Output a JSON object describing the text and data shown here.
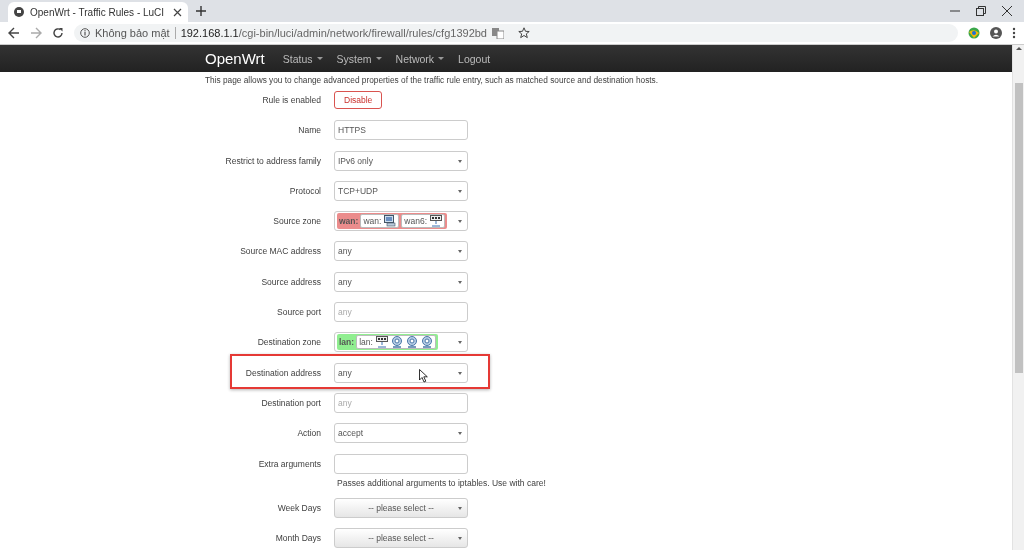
{
  "browser": {
    "tab_title": "OpenWrt - Traffic Rules - LuCI",
    "security_label": "Không bảo mật",
    "url_host": "192.168.1.1",
    "url_path": "/cgi-bin/luci/admin/network/firewall/rules/cfg1392bd"
  },
  "nav": {
    "brand": "OpenWrt",
    "menus": [
      {
        "label": "Status",
        "dropdown": true
      },
      {
        "label": "System",
        "dropdown": true
      },
      {
        "label": "Network",
        "dropdown": true
      },
      {
        "label": "Logout",
        "dropdown": false
      }
    ]
  },
  "intro": "This page allows you to change advanced properties of the traffic rule entry, such as matched source and destination hosts.",
  "rows": [
    {
      "label": "Rule is enabled",
      "kind": "button",
      "value": "Disable",
      "highlighted": false
    },
    {
      "label": "Name",
      "kind": "text",
      "value": "HTTPS",
      "highlighted": false
    },
    {
      "label": "Restrict to address family",
      "kind": "select",
      "value": "IPv6 only",
      "highlighted": false
    },
    {
      "label": "Protocol",
      "kind": "select",
      "value": "TCP+UDP",
      "highlighted": false
    },
    {
      "label": "Source zone",
      "kind": "zone",
      "zone": "wan:",
      "color": "#eb8c8c",
      "networks": [
        {
          "label": "wan:",
          "icons": [
            {
              "kind": "computer"
            }
          ]
        },
        {
          "label": "wan6:",
          "icons": [
            {
              "kind": "port"
            }
          ]
        }
      ],
      "highlighted": false
    },
    {
      "label": "Source MAC address",
      "kind": "select",
      "value": "any",
      "highlighted": false
    },
    {
      "label": "Source address",
      "kind": "select",
      "value": "any",
      "highlighted": false
    },
    {
      "label": "Source port",
      "kind": "text",
      "placeholder": "any",
      "highlighted": false
    },
    {
      "label": "Destination zone",
      "kind": "zone",
      "zone": "lan:",
      "color": "#90ee90",
      "networks": [
        {
          "label": "lan:",
          "icons": [
            {
              "kind": "port"
            },
            {
              "kind": "wireless"
            },
            {
              "kind": "wireless"
            },
            {
              "kind": "wireless"
            }
          ]
        }
      ],
      "highlighted": false
    },
    {
      "label": "Destination address",
      "kind": "select",
      "value": "any",
      "highlighted": true
    },
    {
      "label": "Destination port",
      "kind": "text",
      "placeholder": "any",
      "highlighted": false
    },
    {
      "label": "Action",
      "kind": "select",
      "value": "accept",
      "highlighted": false
    },
    {
      "label": "Extra arguments",
      "kind": "text",
      "help": "Passes additional arguments to iptables. Use with care!",
      "highlighted": false
    },
    {
      "label": "Week Days",
      "kind": "multiselect",
      "value": "-- please select --",
      "highlighted": false
    },
    {
      "label": "Month Days",
      "kind": "multiselect",
      "value": "-- please select --",
      "highlighted": false
    }
  ]
}
